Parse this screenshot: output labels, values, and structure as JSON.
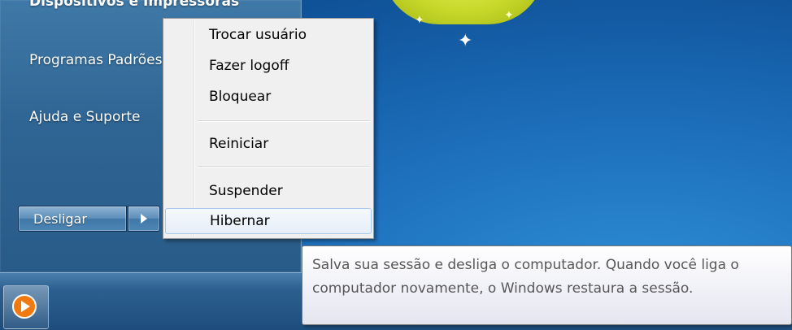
{
  "start_menu": {
    "top_link": "Dispositivos e Impressoras",
    "links": [
      "Programas Padrões",
      "Ajuda e Suporte"
    ],
    "shutdown_label": "Desligar"
  },
  "shutdown_submenu": {
    "items": [
      "Trocar usuário",
      "Fazer logoff",
      "Bloquear",
      "Reiniciar",
      "Suspender",
      "Hibernar"
    ],
    "highlighted": "Hibernar"
  },
  "tooltip": {
    "text": "Salva sua sessão e desliga o computador. Quando você liga o computador novamente, o Windows restaura a sessão."
  },
  "taskbar": {
    "pinned_icons": [
      "windows-media-player-icon"
    ]
  },
  "colors": {
    "desktop_blue": "#1d6fbb",
    "menu_highlight_border": "#a8c8ee",
    "wmp_orange": "#f07a12"
  }
}
